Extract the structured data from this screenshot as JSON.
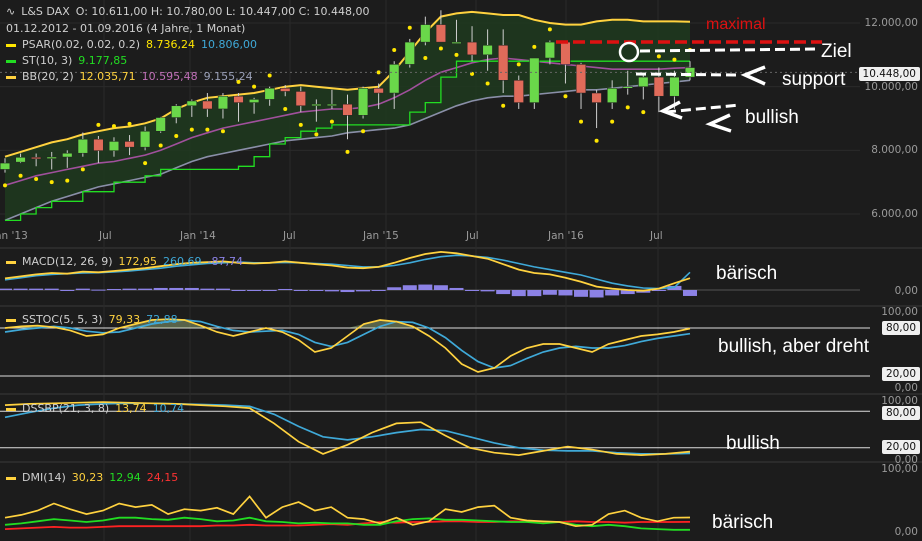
{
  "header": {
    "logo": "∿",
    "instrument": "L&S DAX",
    "ohlc": "O: 10.611,00   H: 10.780,00   L: 10.447,00   C: 10.448,00",
    "range": "01.12.2012 - 01.09.2016 (4 Jahre, 1 Monat)"
  },
  "legend_main": [
    {
      "label": "PSAR(0.02, 0.02, 0.2)",
      "v1": "8.736,24",
      "v2": "10.806,00",
      "color": "#ffe600"
    },
    {
      "label": "ST(10, 3)",
      "v1": "9.177,85",
      "v2": "",
      "color": "#22dd22"
    },
    {
      "label": "BB(20, 2)",
      "v1": "12.035,71",
      "v2": "10.595,48",
      "v3": "9.155,24",
      "color": "#ffd23f"
    }
  ],
  "legend_macd": {
    "label": "MACD(12, 26, 9)",
    "v1": "172,95",
    "v2": "260,69",
    "v3": "-87,74"
  },
  "legend_sstoc": {
    "label": "SSTOC(5, 5, 3)",
    "v1": "79,33",
    "v2": "72,88"
  },
  "legend_dssbp": {
    "label": "DSSBP(21, 3, 8)",
    "v1": "13,74",
    "v2": "10,74"
  },
  "legend_dmi": {
    "label": "DMI(14)",
    "v1": "30,23",
    "v2": "12,94",
    "v3": "24,15"
  },
  "annotations": {
    "maximal": "maximal",
    "ziel": "Ziel",
    "support": "support",
    "bullish_main": "bullish",
    "macd": "bärisch",
    "sstoc": "bullish, aber dreht",
    "dssbp": "bullish",
    "dmi": "bärisch"
  },
  "axis": {
    "main_ticks": [
      "12.000,00",
      "10.000,00",
      "8.000,00",
      "6.000,00"
    ],
    "last_price": "10.448,00",
    "macd_ticks": [
      "0,00"
    ],
    "osc_ticks": [
      "100,00",
      "80,00",
      "20,00",
      "0,00"
    ],
    "x_ticks": [
      "Jan '13",
      "Jul",
      "Jan '14",
      "Jul",
      "Jan '15",
      "Jul",
      "Jan '16",
      "Jul"
    ]
  },
  "colors": {
    "background": "#1c1c1c",
    "up_candle": "#6ad84a",
    "down_candle": "#e06b5a",
    "psar": "#ffe600",
    "supertrend": "#22dd22",
    "bb_upper": "#ffd23f",
    "bb_mid": "#a0509c",
    "bb_lower": "#8a8fa8",
    "macd_line": "#ffd23f",
    "signal_line": "#3fa9d8",
    "histogram": "#8c82e6",
    "maximal": "#dd1111",
    "arrows": "#ffffff"
  },
  "chart_data": [
    {
      "type": "candlestick",
      "title": "L&S DAX",
      "ylim": [
        5500,
        12500
      ],
      "x": [
        "2012-12",
        "2013-01",
        "2013-02",
        "2013-03",
        "2013-04",
        "2013-05",
        "2013-06",
        "2013-07",
        "2013-08",
        "2013-09",
        "2013-10",
        "2013-11",
        "2013-12",
        "2014-01",
        "2014-02",
        "2014-03",
        "2014-04",
        "2014-05",
        "2014-06",
        "2014-07",
        "2014-08",
        "2014-09",
        "2014-10",
        "2014-11",
        "2014-12",
        "2015-01",
        "2015-02",
        "2015-03",
        "2015-04",
        "2015-05",
        "2015-06",
        "2015-07",
        "2015-08",
        "2015-09",
        "2015-10",
        "2015-11",
        "2015-12",
        "2016-01",
        "2016-02",
        "2016-03",
        "2016-04",
        "2016-05",
        "2016-06",
        "2016-07",
        "2016-08"
      ],
      "open": [
        7400,
        7630,
        7780,
        7740,
        7790,
        7910,
        8350,
        7990,
        8280,
        8100,
        8600,
        9030,
        9400,
        9550,
        9300,
        9700,
        9500,
        9600,
        9950,
        9850,
        9400,
        9450,
        9450,
        9100,
        9950,
        9800,
        10700,
        11400,
        11950,
        11400,
        11400,
        11000,
        11300,
        10200,
        9500,
        10900,
        11400,
        10700,
        9800,
        9500,
        9950,
        10000,
        10300,
        9700,
        10300
      ],
      "high": [
        7750,
        7900,
        7900,
        7950,
        8000,
        8560,
        8450,
        8410,
        8480,
        8750,
        9050,
        9450,
        9600,
        9800,
        9800,
        9800,
        9650,
        10000,
        10050,
        10000,
        9600,
        9900,
        9750,
        10000,
        10100,
        10800,
        11500,
        12200,
        12400,
        12100,
        11900,
        11800,
        11800,
        10350,
        10900,
        11450,
        11400,
        10750,
        9900,
        10200,
        10500,
        10400,
        10600,
        10500,
        10800
      ],
      "low": [
        7300,
        7600,
        7500,
        7400,
        7450,
        7800,
        7600,
        7800,
        7850,
        8000,
        8550,
        8850,
        9050,
        9050,
        9000,
        8900,
        9150,
        9400,
        9700,
        9200,
        8900,
        9300,
        8350,
        9000,
        9300,
        9300,
        10600,
        11300,
        11600,
        11400,
        10800,
        10500,
        9800,
        9300,
        9300,
        10700,
        10100,
        9300,
        8700,
        9300,
        9750,
        9600,
        9200,
        9300,
        10200
      ],
      "close": [
        7600,
        7780,
        7740,
        7790,
        7910,
        8350,
        7990,
        8280,
        8100,
        8600,
        9030,
        9400,
        9550,
        9300,
        9700,
        9500,
        9600,
        9950,
        9850,
        9400,
        9450,
        9450,
        9100,
        9950,
        9800,
        10700,
        11400,
        11950,
        11400,
        11400,
        11000,
        11300,
        10200,
        9500,
        10900,
        11400,
        10700,
        9800,
        9500,
        9950,
        10000,
        10300,
        9700,
        10300,
        10600
      ],
      "psar_last": 8736.24,
      "psar_next": 10806.0,
      "supertrend_last": 9177.85,
      "bb_upper_last": 12035.71,
      "bb_mid_last": 10595.48,
      "bb_lower_last": 9155.24,
      "bb_upper": [
        7800,
        7950,
        8100,
        8250,
        8350,
        8500,
        8600,
        8700,
        8750,
        8850,
        9000,
        9300,
        9500,
        9650,
        9700,
        9750,
        9800,
        9900,
        10000,
        10050,
        10000,
        9950,
        9900,
        9950,
        10000,
        10500,
        11100,
        11700,
        12200,
        12300,
        12350,
        12300,
        12250,
        12250,
        12100,
        12000,
        11950,
        11950,
        12050,
        12100,
        12100,
        12050,
        12050,
        12050,
        12040
      ],
      "bb_mid": [
        6900,
        7050,
        7200,
        7300,
        7400,
        7500,
        7600,
        7650,
        7750,
        7850,
        8000,
        8200,
        8400,
        8550,
        8700,
        8800,
        8900,
        9000,
        9100,
        9200,
        9250,
        9300,
        9300,
        9350,
        9450,
        9650,
        9900,
        10200,
        10450,
        10600,
        10750,
        10850,
        10900,
        10850,
        10800,
        10750,
        10700,
        10650,
        10600,
        10550,
        10550,
        10550,
        10550,
        10580,
        10600
      ],
      "bb_lower": [
        5800,
        6000,
        6200,
        6400,
        6550,
        6700,
        6850,
        6950,
        7050,
        7150,
        7250,
        7450,
        7650,
        7800,
        7900,
        8000,
        8100,
        8200,
        8300,
        8350,
        8400,
        8450,
        8550,
        8600,
        8650,
        8700,
        8800,
        9000,
        9200,
        9400,
        9550,
        9650,
        9700,
        9700,
        9750,
        9800,
        9850,
        9900,
        9900,
        9950,
        10000,
        10050,
        10100,
        10150,
        10200
      ],
      "supertrend": [
        5800,
        6000,
        6200,
        6400,
        6400,
        6700,
        6700,
        7000,
        7000,
        7200,
        7400,
        7400,
        7400,
        7400,
        7400,
        7500,
        7800,
        8200,
        8400,
        8600,
        8700,
        8800,
        8800,
        8800,
        8800,
        8800,
        9200,
        9500,
        10300,
        10800,
        10800,
        10800,
        10800,
        10800,
        10800,
        10800,
        10800,
        10800,
        10800,
        10800,
        10800,
        10800,
        10800,
        10800,
        10800
      ]
    },
    {
      "type": "line",
      "title": "MACD(12, 26, 9)",
      "ylim": [
        -400,
        700
      ],
      "series": [
        {
          "name": "MACD",
          "values": [
            170,
            200,
            230,
            250,
            240,
            270,
            260,
            280,
            300,
            320,
            350,
            380,
            400,
            410,
            420,
            400,
            390,
            400,
            420,
            400,
            380,
            360,
            330,
            320,
            340,
            400,
            470,
            530,
            560,
            540,
            500,
            460,
            380,
            300,
            250,
            230,
            180,
            120,
            50,
            20,
            0,
            -10,
            20,
            100,
            172.95
          ]
        },
        {
          "name": "Signal",
          "values": [
            150,
            180,
            210,
            230,
            240,
            250,
            255,
            265,
            280,
            300,
            320,
            350,
            370,
            390,
            400,
            410,
            400,
            400,
            405,
            400,
            390,
            380,
            360,
            340,
            340,
            360,
            400,
            450,
            490,
            510,
            500,
            480,
            440,
            390,
            340,
            300,
            260,
            220,
            160,
            100,
            60,
            30,
            20,
            40,
            260.69
          ]
        },
        {
          "name": "Histogram",
          "values": [
            20,
            20,
            20,
            20,
            0,
            20,
            5,
            15,
            20,
            20,
            30,
            30,
            30,
            20,
            20,
            -10,
            -10,
            0,
            15,
            0,
            -10,
            -20,
            -30,
            -20,
            0,
            40,
            70,
            80,
            70,
            30,
            0,
            -20,
            -60,
            -90,
            -90,
            -70,
            -80,
            -100,
            -110,
            -80,
            -60,
            -40,
            0,
            60,
            -87.74
          ]
        }
      ]
    },
    {
      "type": "line",
      "title": "SSTOC(5, 5, 3)",
      "ylim": [
        0,
        100
      ],
      "series": [
        {
          "name": "%K",
          "values": [
            80,
            82,
            83,
            81,
            77,
            70,
            72,
            80,
            85,
            90,
            91,
            90,
            83,
            75,
            70,
            75,
            80,
            75,
            65,
            50,
            55,
            70,
            85,
            90,
            88,
            82,
            70,
            55,
            35,
            25,
            30,
            45,
            55,
            60,
            60,
            55,
            50,
            60,
            65,
            70,
            72,
            75,
            79.33
          ]
        },
        {
          "name": "%D",
          "values": [
            75,
            78,
            80,
            82,
            80,
            76,
            74,
            75,
            80,
            85,
            88,
            90,
            88,
            82,
            77,
            75,
            76,
            77,
            72,
            62,
            57,
            62,
            72,
            82,
            88,
            87,
            80,
            68,
            52,
            38,
            30,
            33,
            42,
            50,
            55,
            57,
            55,
            55,
            58,
            63,
            67,
            70,
            72.88
          ]
        }
      ]
    },
    {
      "type": "line",
      "title": "DSSBP(21, 3, 8)",
      "ylim": [
        0,
        100
      ],
      "series": [
        {
          "name": "DSS",
          "values": [
            90,
            92,
            93,
            94,
            95,
            94,
            93,
            92,
            90,
            88,
            85,
            60,
            30,
            10,
            25,
            45,
            60,
            62,
            40,
            20,
            12,
            8,
            15,
            22,
            17,
            10,
            8,
            10,
            13.74
          ]
        },
        {
          "name": "Signal",
          "values": [
            70,
            78,
            85,
            90,
            92,
            93,
            93,
            92,
            91,
            90,
            88,
            75,
            55,
            38,
            33,
            38,
            45,
            50,
            48,
            38,
            28,
            20,
            16,
            15,
            15,
            12,
            10,
            10,
            10.74
          ]
        }
      ]
    },
    {
      "type": "line",
      "title": "DMI(14)",
      "ylim": [
        0,
        100
      ],
      "series": [
        {
          "name": "ADX",
          "values": [
            30,
            34,
            40,
            50,
            42,
            35,
            40,
            50,
            45,
            48,
            35,
            42,
            40,
            44,
            35,
            60,
            30,
            45,
            52,
            40,
            45,
            30,
            28,
            22,
            30,
            20,
            25,
            42,
            38,
            45,
            47,
            30,
            26,
            25,
            24,
            18,
            20,
            35,
            40,
            30,
            25,
            30,
            30.23
          ]
        },
        {
          "name": "+DI",
          "values": [
            20,
            22,
            25,
            28,
            26,
            24,
            26,
            30,
            30,
            28,
            27,
            30,
            28,
            25,
            26,
            30,
            25,
            24,
            22,
            23,
            22,
            22,
            20,
            20,
            25,
            28,
            29,
            27,
            27,
            26,
            25,
            24,
            24,
            22,
            24,
            20,
            18,
            20,
            18,
            15,
            14,
            13,
            12.94
          ]
        },
        {
          "name": "-DI",
          "values": [
            14,
            15,
            16,
            17,
            16,
            16,
            17,
            18,
            18,
            18,
            18,
            18,
            18,
            19,
            19,
            20,
            19,
            19,
            19,
            20,
            21,
            20,
            22,
            24,
            23,
            24,
            24,
            25,
            25,
            24,
            24,
            25,
            25,
            24,
            24,
            25,
            24,
            24,
            23,
            24,
            24,
            24,
            24.15
          ]
        }
      ]
    }
  ]
}
